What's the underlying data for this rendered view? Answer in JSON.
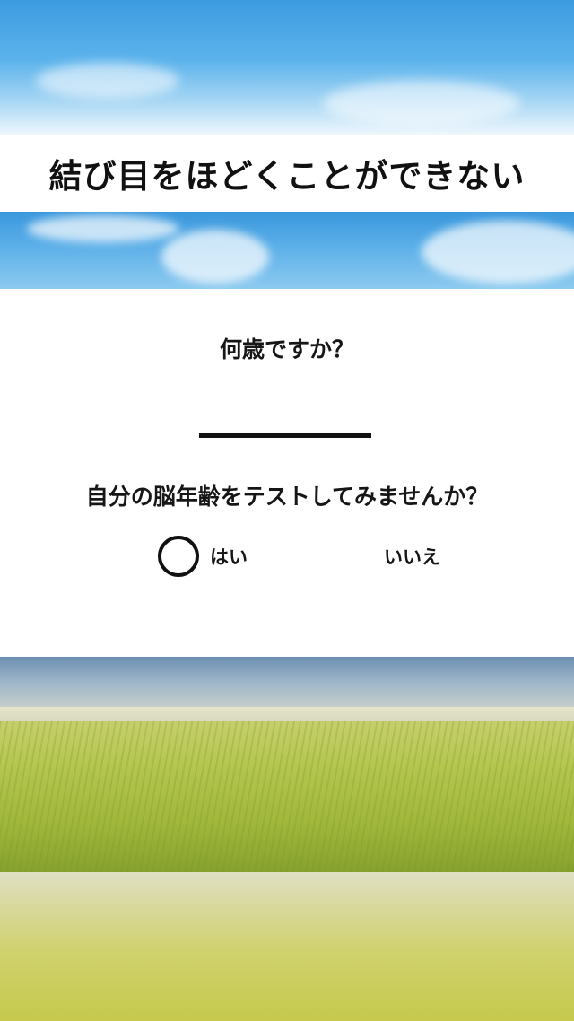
{
  "title": "結び目をほどくことができない",
  "quiz": {
    "question": "何歳ですか？",
    "prompt": "自分の脳年齢をテストしてみませんか？",
    "options": {
      "yes": "はい",
      "no": "いいえ"
    },
    "selected": "yes"
  },
  "colors": {
    "sky": "#4aa6e6",
    "field": "#b5c64f",
    "text": "#161616"
  }
}
